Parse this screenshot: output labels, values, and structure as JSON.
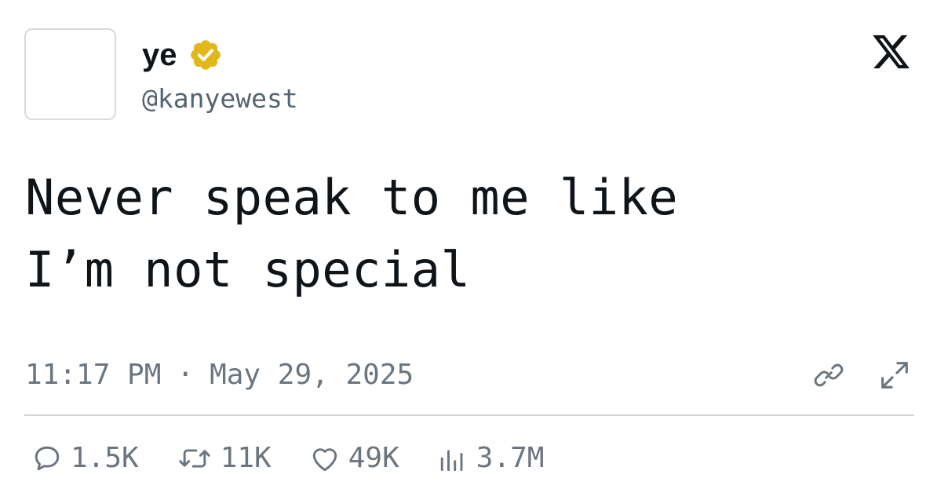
{
  "author": {
    "display_name": "ye",
    "handle": "@kanyewest"
  },
  "icons": {
    "verified": "verified-badge-icon",
    "platform": "x-logo-icon",
    "copy_link": "link-icon",
    "expand": "expand-icon",
    "reply": "reply-icon",
    "repost": "repost-icon",
    "like": "heart-icon",
    "views": "views-icon"
  },
  "colors": {
    "text": "#0f1419",
    "muted": "#6b7580",
    "verified_gold": "#e2b719",
    "divider": "#cfd4d9"
  },
  "tweet": {
    "lines": [
      "Never speak to me like",
      "I’m not special"
    ],
    "time": "11:17 PM",
    "separator": "·",
    "date": "May 29, 2025"
  },
  "stats": {
    "replies": "1.5K",
    "reposts": "11K",
    "likes": "49K",
    "views": "3.7M"
  }
}
